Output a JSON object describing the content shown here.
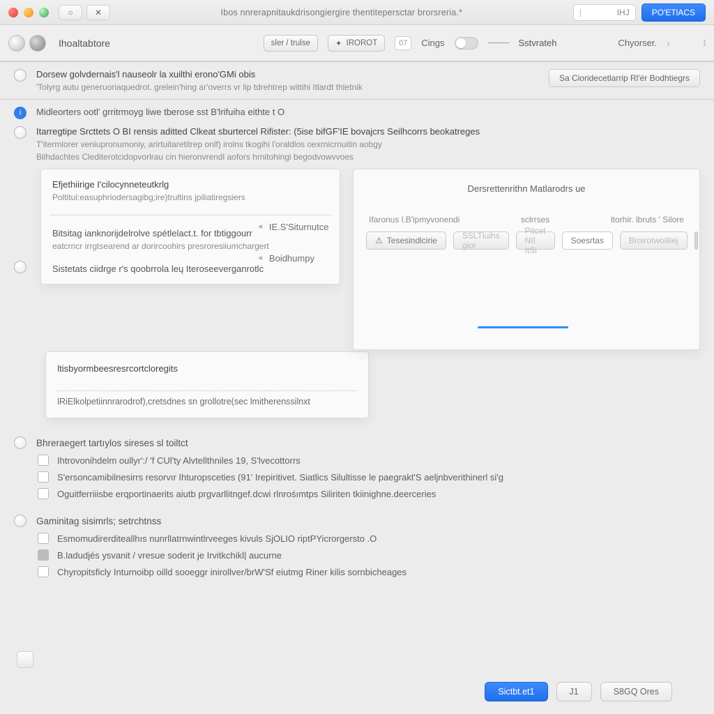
{
  "titlebar": {
    "nav_glyph": "○",
    "close_glyph": "✕",
    "center_text": "Ibos nnrerapnitaukdrisongiergire thentitepersctar brorsreria.*",
    "num_prefix": "|",
    "num_label": "IHJ",
    "primary": "PO'ETlACS"
  },
  "toolbar": {
    "tab_label": "Ihoaltabtore",
    "seg_btn": "sler / trulse",
    "chip1": "IROROT",
    "counter1": "07",
    "chip2": "Cings",
    "switch_label": "Sstvrateh",
    "right_label": "Chyorser.",
    "right_glyph": "᎒"
  },
  "sec1": {
    "title": "Dorsew golvdernais'l nauseolr la xuilthi erono'GMi obis",
    "sub": "'Tolyrg autu generuoriaquedrot. grelein'hing ar'overrs vr lip  tdrehtrep wittihi Itlardt thletnik",
    "btn": "Sa Cioridecetlarrip Rl'ér Bodhtiegrs"
  },
  "info": {
    "line": "Midleorters ootl' grritrmoyg liwe tberose sst B'lrifuiha eithte t O"
  },
  "sec2": {
    "title": "Itarregtipe Srcttets O BI rensis aditted Clkeat sburtercel Rifister: (5ise bifGF'IE bovajcrs  Seilhcorrs beokatreges",
    "line1": "T'itermlorer veniupronumoniy, arirtuitaretitrep onlf) irolns tkogihi l'oraldlos  oexrnicrnuitin aobgy",
    "line2": "Bilhdachtes Clediterotcidopvorlrau cin hieronvrendl aofors hrnitohingi begodvowvvoes"
  },
  "left_panel": {
    "b1_title": "Efjethiirige I'cilocynneteutkrlg",
    "b1_sub": "Poltitul:easuphriodersagibg;ire)trultins jpiliatiregsiers",
    "b2_title": "Bitsitag  ianknorijdelrolve spétlelact.t. for tbtiggourr",
    "b2_sub": "eatcrncr irrgtsearend ar dorircoohirs presroresiiumchargert",
    "b3": "Sistetats  ciidrge r's qoobrrola leų Iteroseeverganrotlc"
  },
  "right_panel": {
    "title": "Dersrettenrithn Matlarodrs ue",
    "col1": "Ifaronus  l.B'ipmyvonendi",
    "col2": "sclrrses",
    "col3": "ltorhir. lbruts ' Silore",
    "tool1": "Tesesindlcirie",
    "tool2": "SSLTluihs gior",
    "tool3": "Pitcet NII ItSi",
    "tool4": "Soesrtas",
    "tool5": "Broirotwoilliej"
  },
  "stack": {
    "item1": "IE.S'Siturnutce",
    "item2": "Boidhumpy"
  },
  "lower": {
    "title": "ltisbyormbeesresrcortcloregits",
    "line": "lRiElkolpetiinnrarodrof),cretsdnes sn grollotre(sec lmitherenssilnxt"
  },
  "group1": {
    "title": "Bhreraegert tartıylos sireses sl toiltct",
    "opt1": "Ihtrovonihdelm oullyr':/ 'f CUl'ty Alvtellthniles  19, S'lvecottorrs",
    "opt2": "S'ersoncamibilnesirrs resorvır Ihturopsceties (91' Irepiritivet. Siatlics  Silultisse le paegrakt'S aeljnbverithinerl si'g",
    "opt3": "Oguitferriiisbe  erqportinaerits aiutb prgvarllitngef.dcwi rlnrośımtps Siliriten tkiinighne.deerceries"
  },
  "group2": {
    "title": "Gaminitag sisimrls; setrchtnss",
    "opt1": "Esmomudirerditeallhıs nunrllatrnwintlrveeges kivuls SjOLIO riptPYicrorgersto .O",
    "opt2": "B.ladudjés ysvanit / vresue soderit je Irvitkchikl| aucurne",
    "opt3": "Chyropitsficly Inturnoibp oilld sooeggr inirollver/brW'Sf eiutmg Riner kilis sornbicheages"
  },
  "footer": {
    "primary": "Sictbt.et1 ",
    "mid": "J1",
    "right": "S8GQ Ores"
  }
}
